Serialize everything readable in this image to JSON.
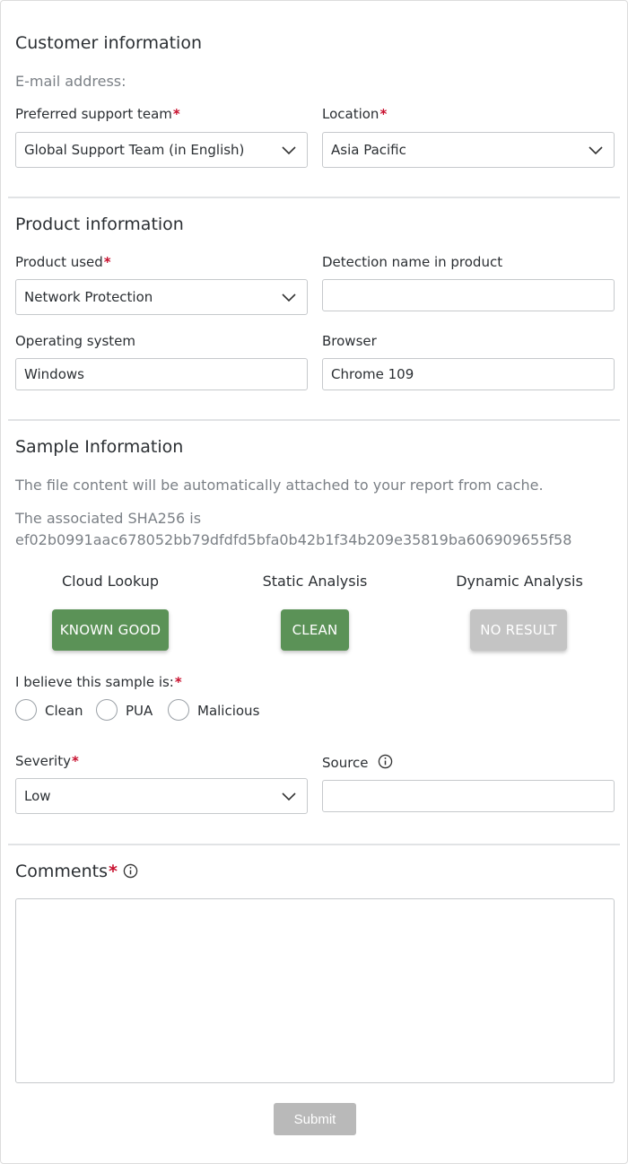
{
  "customer": {
    "title": "Customer information",
    "email_label": "E-mail address:",
    "support_team_label": "Preferred support team",
    "support_team_value": "Global Support Team (in English)",
    "location_label": "Location",
    "location_value": "Asia Pacific",
    "required_mark": "*"
  },
  "product": {
    "title": "Product information",
    "product_used_label": "Product used",
    "product_used_value": "Network Protection",
    "detection_label": "Detection name in product",
    "detection_value": "",
    "os_label": "Operating system",
    "os_value": "Windows",
    "browser_label": "Browser",
    "browser_value": "Chrome 109"
  },
  "sample": {
    "title": "Sample Information",
    "cache_note": "The file content will be automatically attached to your report from cache.",
    "sha_line": "The associated SHA256 is",
    "sha_value": "ef02b0991aac678052bb79dfdfd5bfa0b42b1f34b209e35819ba606909655f58",
    "statuses": [
      {
        "title": "Cloud Lookup",
        "result": "KNOWN GOOD",
        "color": "#5b9257"
      },
      {
        "title": "Static Analysis",
        "result": "CLEAN",
        "color": "#5b9257"
      },
      {
        "title": "Dynamic Analysis",
        "result": "NO RESULT",
        "color": "#c4c4c4"
      }
    ],
    "belief_label": "I believe this sample is:",
    "belief_options": [
      "Clean",
      "PUA",
      "Malicious"
    ],
    "severity_label": "Severity",
    "severity_value": "Low",
    "source_label": "Source",
    "source_value": ""
  },
  "comments": {
    "title": "Comments",
    "value": ""
  },
  "submit_label": "Submit",
  "colors": {
    "required": "#c8102e",
    "accent_green": "#5b9257",
    "disabled_gray": "#b9b9b9"
  }
}
